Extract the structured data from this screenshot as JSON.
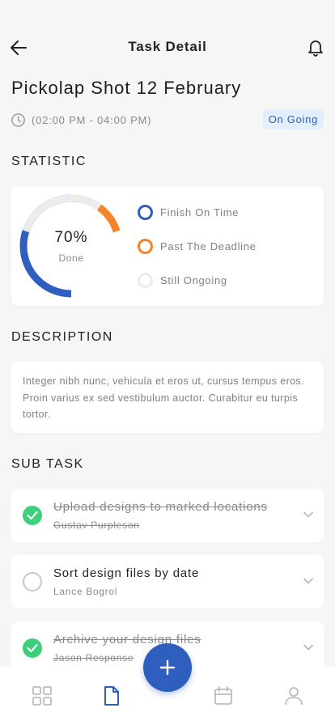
{
  "header": {
    "title": "Task Detail",
    "back_icon": "arrow-left-icon",
    "bell_icon": "bell-icon"
  },
  "task": {
    "title": "Pickolap Shot 12 February",
    "time": "(02:00 PM - 04:00 PM)",
    "status": "On Going"
  },
  "statistic": {
    "section_title": "STATISTIC",
    "percent_text": "70%",
    "done_label": "Done",
    "percent_value": 0.7,
    "segments": [
      {
        "label": "Finish On Time",
        "value": 0.5,
        "color": "#2f5fbe"
      },
      {
        "label": "Past The Deadline",
        "value": 0.2,
        "color": "#f5832a"
      },
      {
        "label": "Still Ongoing",
        "value": 0.3,
        "color": "#ececee"
      }
    ]
  },
  "description": {
    "section_title": "DESCRIPTION",
    "text": "Integer nibh nunc, vehicula et eros ut, cursus tempus eros. Proin varius ex sed vestibulum auctor. Curabitur eu turpis tortor."
  },
  "subtasks": {
    "section_title": "SUB TASK",
    "items": [
      {
        "title": "Upload designs to marked locations",
        "person": "Gustav Purpleson",
        "done": true
      },
      {
        "title": "Sort design files by date",
        "person": "Lance Bogrol",
        "done": false
      },
      {
        "title": "Archive your design files",
        "person": "Jason Response",
        "done": true
      }
    ]
  },
  "colors": {
    "accent": "#2f5fbe",
    "orange": "#f5832a",
    "success": "#3ecf7a"
  },
  "bottom_nav": [
    {
      "name": "dashboard-icon"
    },
    {
      "name": "document-icon",
      "active": true
    },
    {
      "name": "calendar-icon"
    },
    {
      "name": "profile-icon"
    }
  ],
  "fab_icon": "plus-icon"
}
